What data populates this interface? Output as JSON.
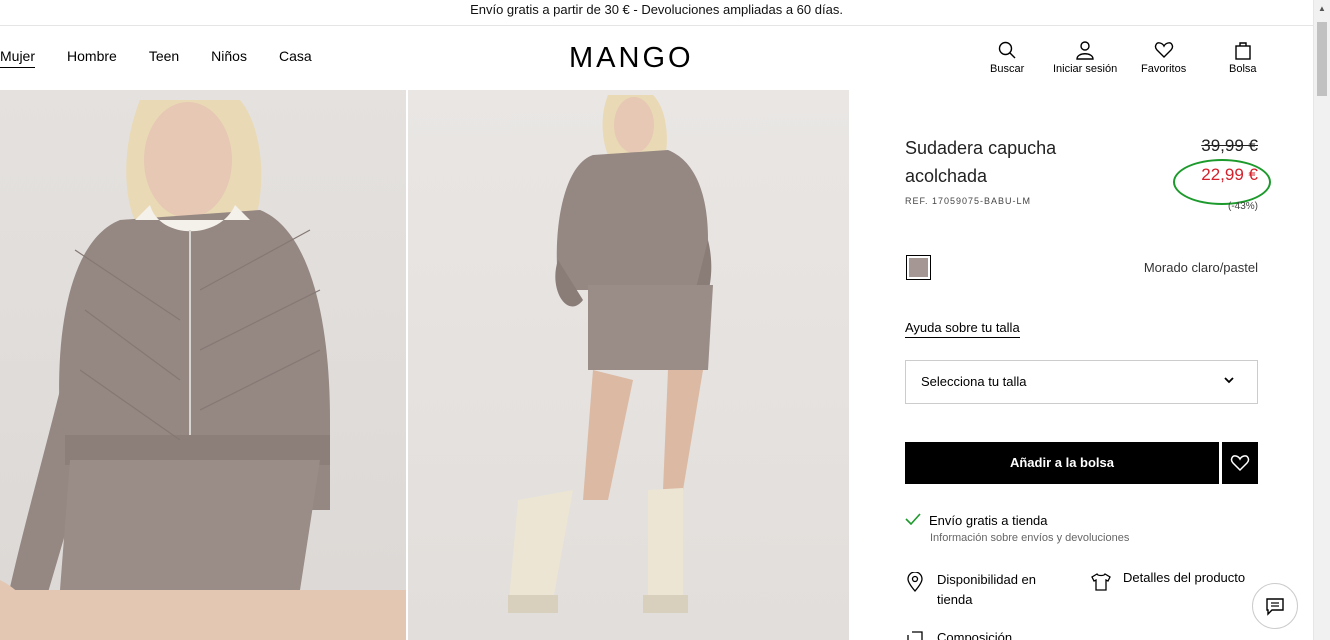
{
  "promo": "Envío gratis a partir de 30 € - Devoluciones ampliadas a 60 días.",
  "nav": [
    "Mujer",
    "Hombre",
    "Teen",
    "Niños",
    "Casa"
  ],
  "logo": "MANGO",
  "header_actions": {
    "search": "Buscar",
    "login": "Iniciar sesión",
    "favorites": "Favoritos",
    "bag": "Bolsa"
  },
  "product": {
    "title": "Sudadera capucha acolchada",
    "ref": "REF. 17059075-BABU-LM",
    "old_price": "39,99 €",
    "new_price": "22,99 €",
    "discount": "(-43%)",
    "color_name": "Morado claro/pastel",
    "swatch_color": "#a59894",
    "size_help": "Ayuda sobre tu talla",
    "size_placeholder": "Selecciona tu talla",
    "add_to_bag": "Añadir a la bolsa",
    "shipping": "Envío gratis a tienda",
    "shipping_info": "Información sobre envíos y devoluciones",
    "availability": "Disponibilidad en tienda",
    "details": "Detalles del producto",
    "more": "Composición"
  },
  "colors": {
    "sale_red": "#d3202b",
    "annotation_green": "#1d9a2c"
  }
}
